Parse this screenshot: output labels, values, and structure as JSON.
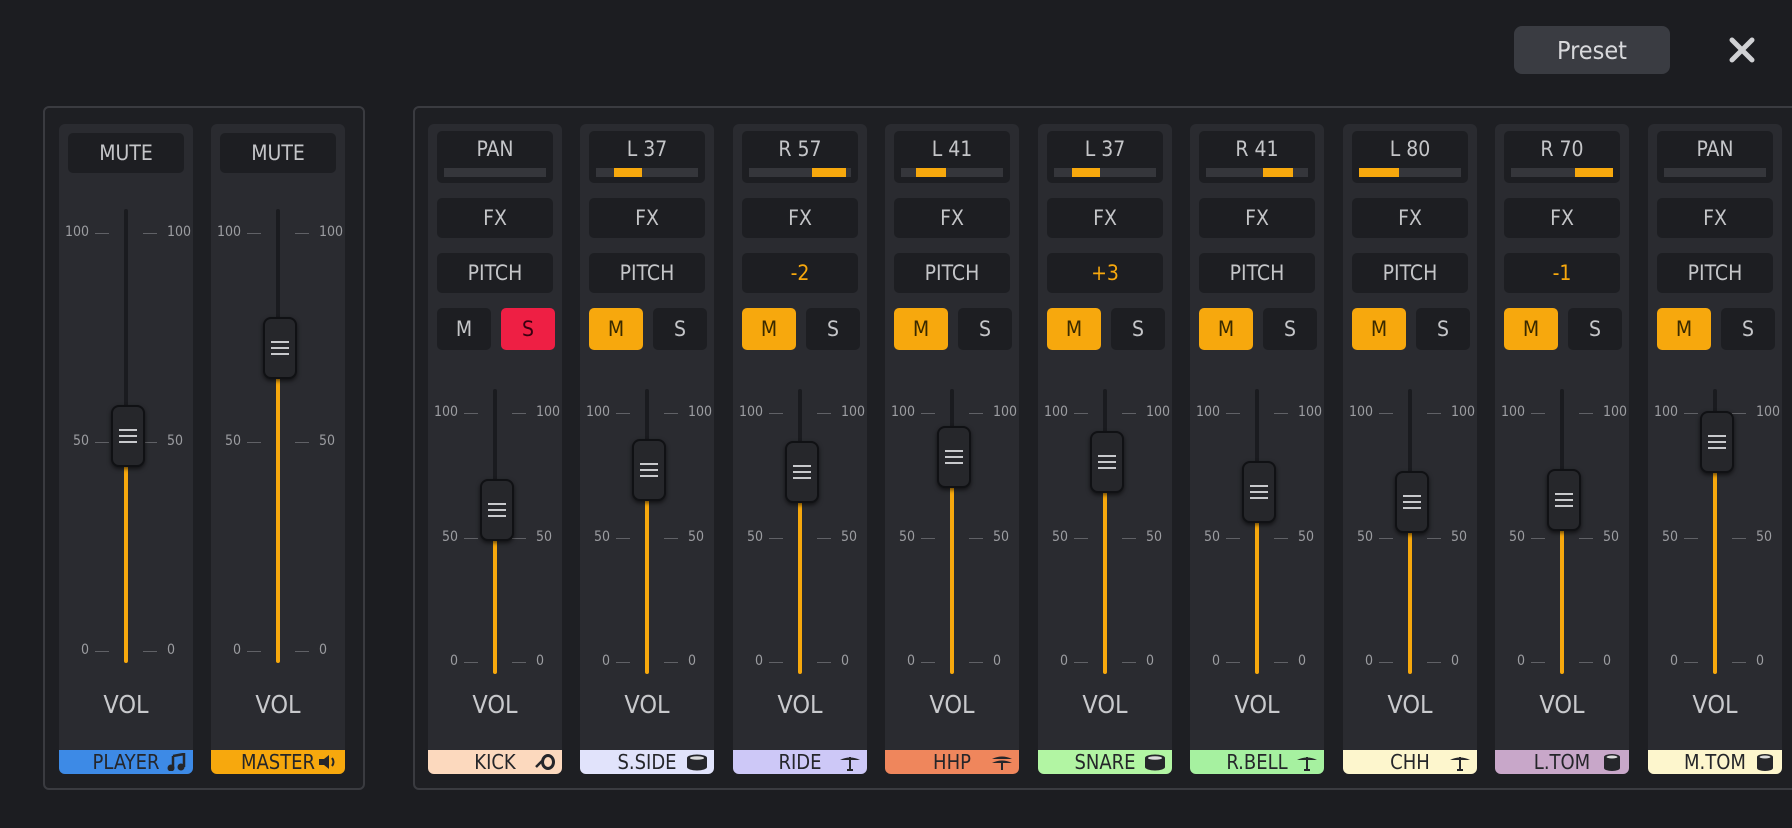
{
  "header": {
    "preset_label": "Preset"
  },
  "colors": {
    "accent": "#f7a80d",
    "solo_on": "#ee1f44",
    "strip_bg": "#2a2b30",
    "page_bg": "#1c1d21"
  },
  "master_strips": [
    {
      "mute_label": "MUTE",
      "volume": 52,
      "vol_label": "VOL",
      "name": "PLAYER",
      "icon": "music-note-icon",
      "color": "#3d8ae6"
    },
    {
      "mute_label": "MUTE",
      "volume": 73,
      "vol_label": "VOL",
      "name": "MASTER",
      "icon": "speaker-icon",
      "color": "#f7a80d"
    }
  ],
  "master_scale": {
    "top": "100",
    "mid": "50",
    "bottom": "0"
  },
  "channel_scale": {
    "top": "100",
    "mid": "50",
    "bottom": "0"
  },
  "channels": [
    {
      "pan_label": "PAN",
      "pan": 0,
      "fx_label": "FX",
      "pitch_label": "PITCH",
      "mute_label": "M",
      "solo_label": "S",
      "mute": false,
      "solo": true,
      "volume": 62,
      "vol_label": "VOL",
      "name": "KICK",
      "icon": "kick-drum-icon",
      "color": "#fcd9be"
    },
    {
      "pan_label": "L 37",
      "pan": -37,
      "fx_label": "FX",
      "pitch_label": "PITCH",
      "mute_label": "M",
      "solo_label": "S",
      "mute": true,
      "solo": false,
      "volume": 78,
      "vol_label": "VOL",
      "name": "S.SIDE",
      "icon": "snare-drum-icon",
      "color": "#e1e3fb"
    },
    {
      "pan_label": "R 57",
      "pan": 57,
      "fx_label": "FX",
      "pitch_label": "-2",
      "mute_label": "M",
      "solo_label": "S",
      "mute": true,
      "solo": false,
      "volume": 77,
      "vol_label": "VOL",
      "name": "RIDE",
      "icon": "cymbal-icon",
      "color": "#cdc8f7"
    },
    {
      "pan_label": "L 41",
      "pan": -41,
      "fx_label": "FX",
      "pitch_label": "PITCH",
      "mute_label": "M",
      "solo_label": "S",
      "mute": true,
      "solo": false,
      "volume": 83,
      "vol_label": "VOL",
      "name": "HHP",
      "icon": "hihat-icon",
      "color": "#ef865c"
    },
    {
      "pan_label": "L 37",
      "pan": -37,
      "fx_label": "FX",
      "pitch_label": "+3",
      "mute_label": "M",
      "solo_label": "S",
      "mute": true,
      "solo": false,
      "volume": 81,
      "vol_label": "VOL",
      "name": "SNARE",
      "icon": "snare-drum-icon",
      "color": "#b2f5a3"
    },
    {
      "pan_label": "R 41",
      "pan": 41,
      "fx_label": "FX",
      "pitch_label": "PITCH",
      "mute_label": "M",
      "solo_label": "S",
      "mute": true,
      "solo": false,
      "volume": 69,
      "vol_label": "VOL",
      "name": "R.BELL",
      "icon": "cymbal-icon",
      "color": "#a6f1a0"
    },
    {
      "pan_label": "L 80",
      "pan": -80,
      "fx_label": "FX",
      "pitch_label": "PITCH",
      "mute_label": "M",
      "solo_label": "S",
      "mute": true,
      "solo": false,
      "volume": 65,
      "vol_label": "VOL",
      "name": "CHH",
      "icon": "cymbal-icon",
      "color": "#fdf6cd"
    },
    {
      "pan_label": "R 70",
      "pan": 70,
      "fx_label": "FX",
      "pitch_label": "-1",
      "mute_label": "M",
      "solo_label": "S",
      "mute": true,
      "solo": false,
      "volume": 66,
      "vol_label": "VOL",
      "name": "L.TOM",
      "icon": "tom-drum-icon",
      "color": "#c8a7c9"
    },
    {
      "pan_label": "PAN",
      "pan": 0,
      "fx_label": "FX",
      "pitch_label": "PITCH",
      "mute_label": "M",
      "solo_label": "S",
      "mute": true,
      "solo": false,
      "volume": 89,
      "vol_label": "VOL",
      "name": "M.TOM",
      "icon": "tom-drum-icon",
      "color": "#fdf6cd"
    }
  ]
}
